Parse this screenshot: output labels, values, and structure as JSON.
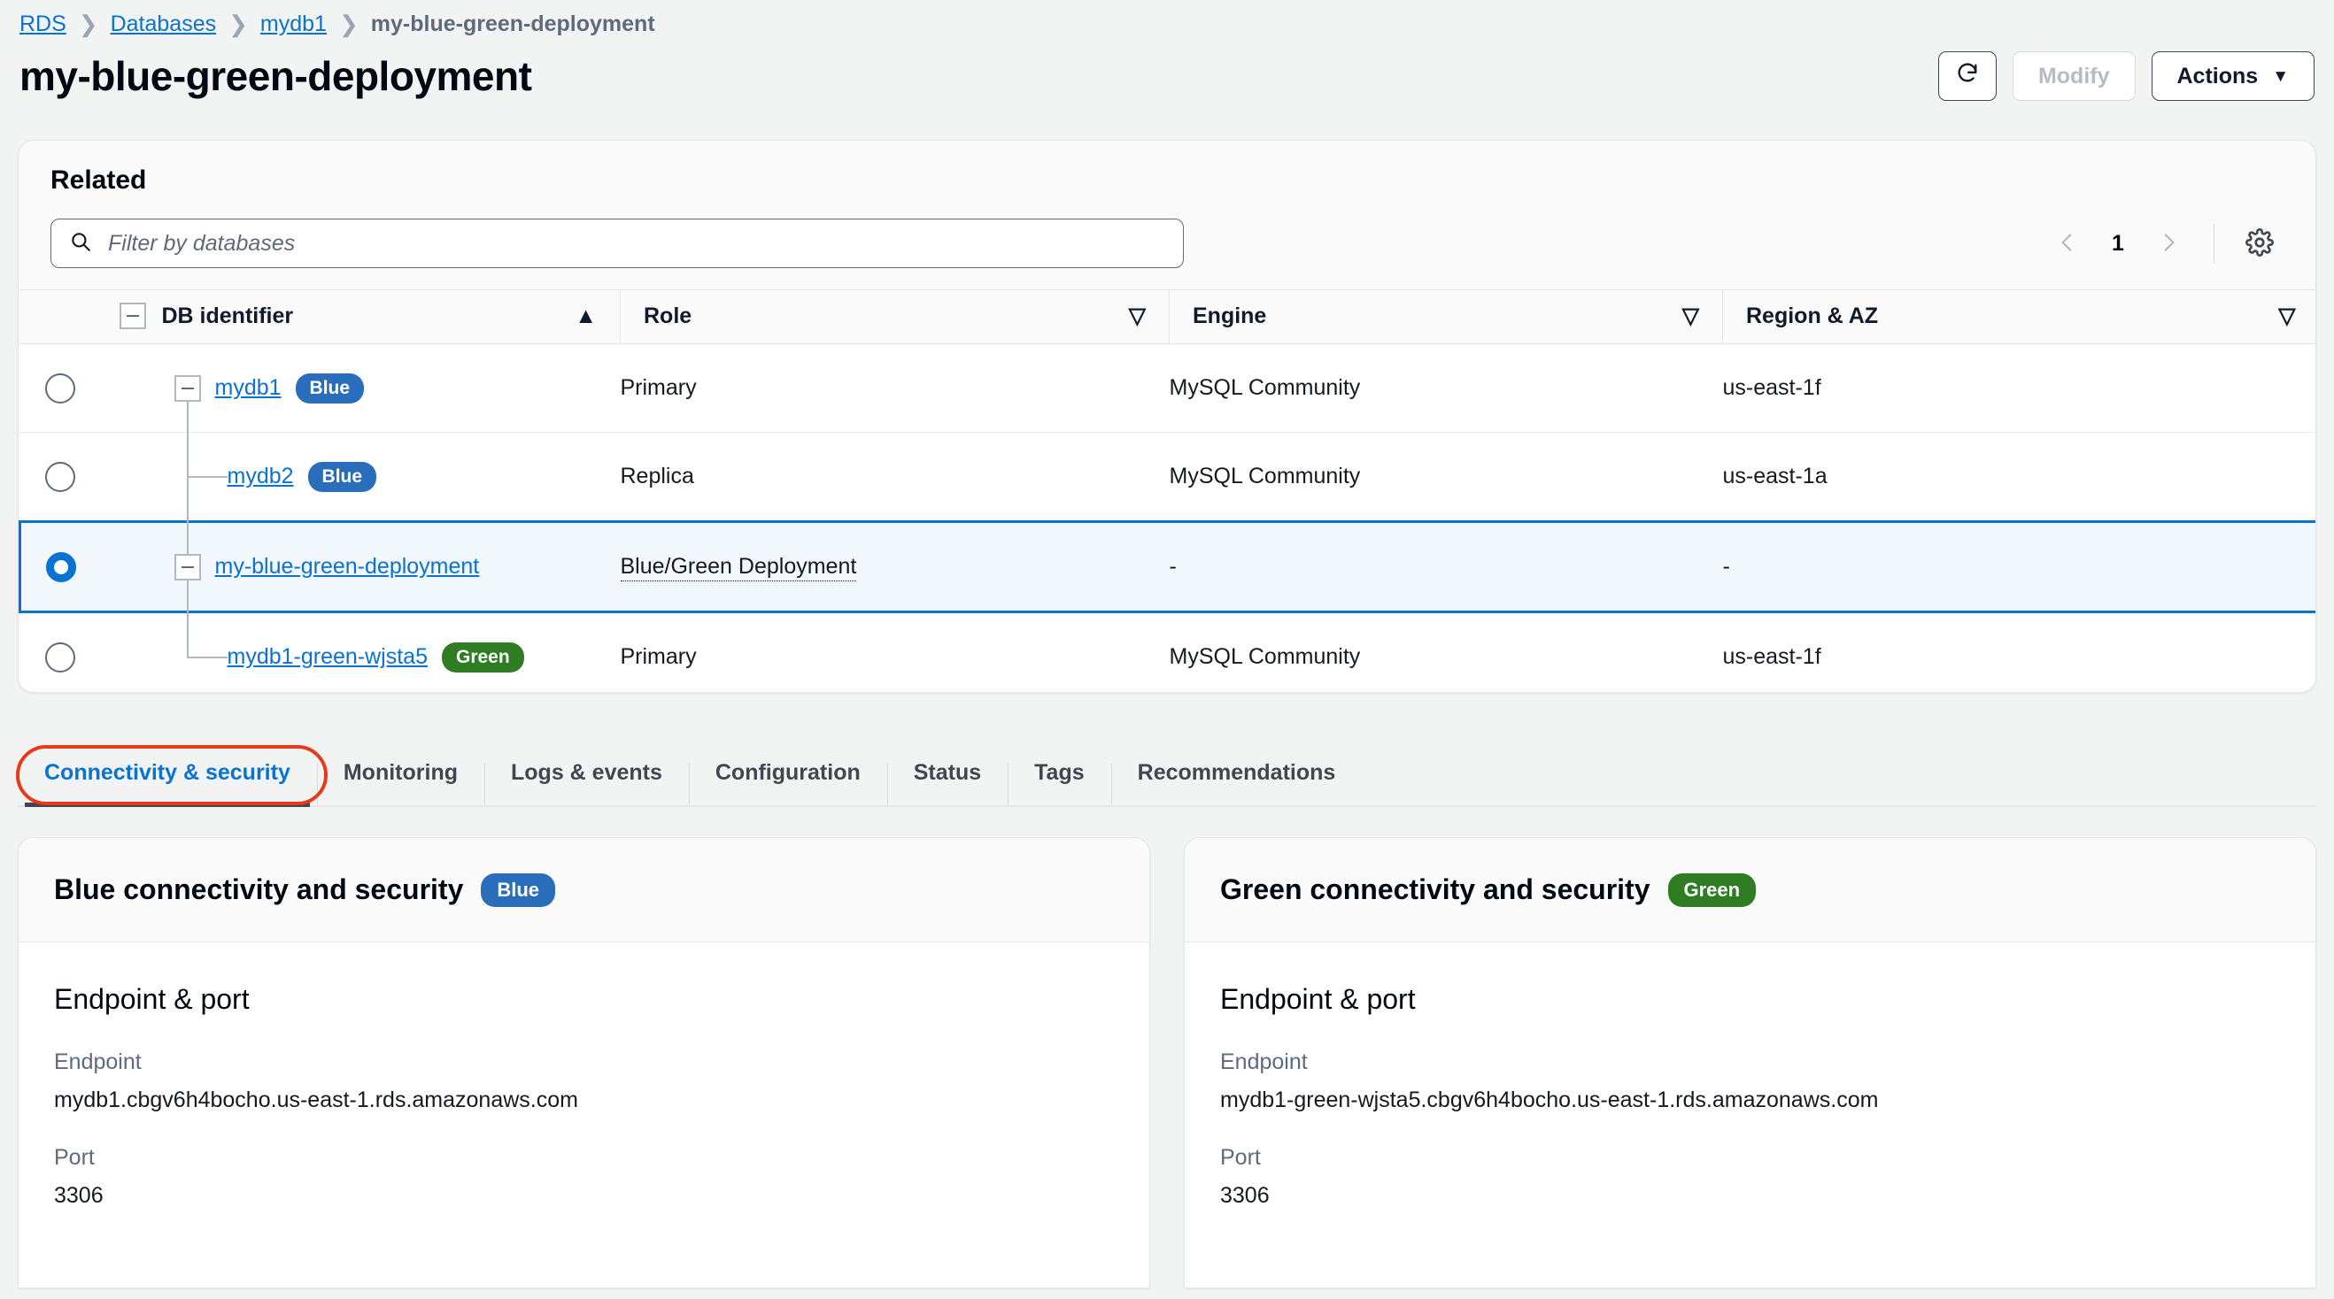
{
  "breadcrumb": [
    {
      "label": "RDS",
      "link": true
    },
    {
      "label": "Databases",
      "link": true
    },
    {
      "label": "mydb1",
      "link": true
    },
    {
      "label": "my-blue-green-deployment",
      "link": false
    }
  ],
  "header": {
    "title": "my-blue-green-deployment",
    "refresh_icon": "refresh-icon",
    "modify_label": "Modify",
    "actions_label": "Actions",
    "actions_caret": "▼"
  },
  "related": {
    "title": "Related",
    "search": {
      "icon": "search-icon",
      "placeholder": "Filter by databases",
      "value": ""
    },
    "pagination": {
      "prev_icon": "chevron-left-icon",
      "page": "1",
      "next_icon": "chevron-right-icon",
      "settings_icon": "gear-icon"
    },
    "columns": [
      {
        "label": "DB identifier",
        "sort": "asc",
        "sort_glyph": "▲"
      },
      {
        "label": "Role",
        "sort": "none",
        "sort_glyph": "▽"
      },
      {
        "label": "Engine",
        "sort": "none",
        "sort_glyph": "▽"
      },
      {
        "label": "Region & AZ",
        "sort": "none",
        "sort_glyph": "▽"
      }
    ],
    "rows": [
      {
        "id": "mydb1",
        "badge": "Blue",
        "badge_color": "#2a6ebb",
        "role": "Primary",
        "engine": "MySQL Community",
        "region": "us-east-1f",
        "selected": false,
        "expandable": true,
        "child": false,
        "role_dotted": false
      },
      {
        "id": "mydb2",
        "badge": "Blue",
        "badge_color": "#2a6ebb",
        "role": "Replica",
        "engine": "MySQL Community",
        "region": "us-east-1a",
        "selected": false,
        "expandable": false,
        "child": true,
        "role_dotted": false
      },
      {
        "id": "my-blue-green-deployment",
        "badge": "",
        "badge_color": "",
        "role": "Blue/Green Deployment",
        "engine": "-",
        "region": "-",
        "selected": true,
        "expandable": true,
        "child": false,
        "role_dotted": true
      },
      {
        "id": "mydb1-green-wjsta5",
        "badge": "Green",
        "badge_color": "#2e7d23",
        "role": "Primary",
        "engine": "MySQL Community",
        "region": "us-east-1f",
        "selected": false,
        "expandable": false,
        "child": true,
        "role_dotted": false
      }
    ]
  },
  "tabs": [
    {
      "label": "Connectivity & security",
      "active": true
    },
    {
      "label": "Monitoring",
      "active": false
    },
    {
      "label": "Logs & events",
      "active": false
    },
    {
      "label": "Configuration",
      "active": false
    },
    {
      "label": "Status",
      "active": false
    },
    {
      "label": "Tags",
      "active": false
    },
    {
      "label": "Recommendations",
      "active": false
    }
  ],
  "panels": [
    {
      "title": "Blue connectivity and security",
      "badge": "Blue",
      "badge_color": "#2a6ebb",
      "section": "Endpoint & port",
      "endpoint_label": "Endpoint",
      "endpoint_value": "mydb1.cbgv6h4bocho.us-east-1.rds.amazonaws.com",
      "port_label": "Port",
      "port_value": "3306"
    },
    {
      "title": "Green connectivity and security",
      "badge": "Green",
      "badge_color": "#2e7d23",
      "section": "Endpoint & port",
      "endpoint_label": "Endpoint",
      "endpoint_value": "mydb1-green-wjsta5.cbgv6h4bocho.us-east-1.rds.amazonaws.com",
      "port_label": "Port",
      "port_value": "3306"
    }
  ]
}
